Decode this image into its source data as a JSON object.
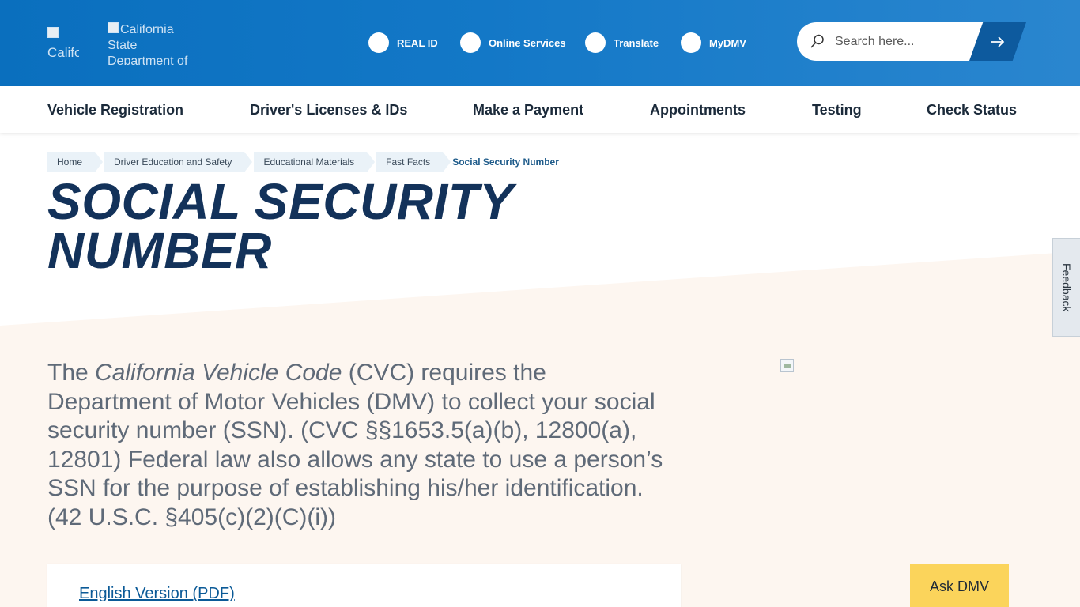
{
  "header": {
    "logo_primary_alt": "Californ",
    "logo_secondary_alt": "California State Department of",
    "top_links": [
      "REAL ID",
      "Online Services",
      "Translate",
      "MyDMV"
    ],
    "search": {
      "placeholder": "Search here...",
      "button_icon": "arrow-right-icon"
    }
  },
  "nav": {
    "items": [
      "Vehicle Registration",
      "Driver's Licenses & IDs",
      "Make a Payment",
      "Appointments",
      "Testing",
      "Check Status"
    ]
  },
  "breadcrumb": [
    "Home",
    "Driver Education and Safety",
    "Educational Materials",
    "Fast Facts",
    "Social Security Number"
  ],
  "main": {
    "title_line1": "SOCIAL SECURITY",
    "title_line2": "NUMBER",
    "intro_pre": "The ",
    "intro_em": "California Vehicle Code",
    "intro_post": " (CVC) requires the Department of Motor Vehicles (DMV) to collect your social security number (SSN). (CVC §§1653.5(a)(b), 12800(a), 12801) Federal law also allows any state to use a person’s SSN for the purpose of establishing his/her identification. (42 U.S.C. §405(c)(2)(C)(i))",
    "pdf_link": "English Version (PDF)"
  },
  "widgets": {
    "ask_button": "Ask DMV",
    "feedback": "Feedback"
  },
  "colors": {
    "header_blue": "#0a6fbe",
    "title_navy": "#13325a",
    "ask_yellow": "#fbd45b",
    "content_bg": "#fdf6f0"
  }
}
